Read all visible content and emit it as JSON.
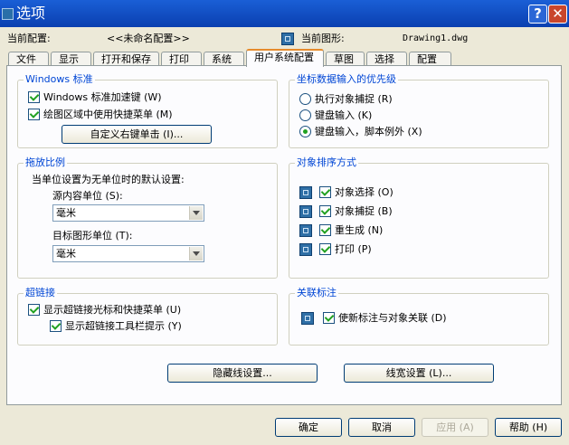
{
  "window": {
    "title": "选项",
    "help_label": "?",
    "close_label": "✕"
  },
  "profile": {
    "label": "当前配置:",
    "value": "<<未命名配置>>"
  },
  "drawing": {
    "label": "当前图形:",
    "value": "Drawing1.dwg"
  },
  "tabs": [
    "文件",
    "显示",
    "打开和保存",
    "打印",
    "系统",
    "用户系统配置",
    "草图",
    "选择",
    "配置"
  ],
  "active_tab": "用户系统配置",
  "windows_std": {
    "title": "Windows 标准",
    "accel_keys": "Windows 标准加速键 (W)",
    "shortcut_menus": "绘图区域中使用快捷菜单 (M)",
    "right_click_button": "自定义右键单击 (I)..."
  },
  "priority": {
    "title": "坐标数据输入的优先级",
    "options": [
      "执行对象捕捉 (R)",
      "键盘输入 (K)",
      "键盘输入，脚本例外 (X)"
    ],
    "selected": 2
  },
  "insert_scale": {
    "title": "拖放比例",
    "desc": "当单位设置为无单位时的默认设置:",
    "source_label": "源内容单位 (S):",
    "source_value": "毫米",
    "target_label": "目标图形单位 (T):",
    "target_value": "毫米"
  },
  "sort": {
    "title": "对象排序方式",
    "items": [
      "对象选择 (O)",
      "对象捕捉 (B)",
      "重生成 (N)",
      "打印 (P)"
    ]
  },
  "hyperlink": {
    "title": "超链接",
    "cursor_menus": "显示超链接光标和快捷菜单 (U)",
    "tooltip": "显示超链接工具栏提示 (Y)"
  },
  "assoc": {
    "title": "关联标注",
    "item": "使新标注与对象关联 (D)"
  },
  "buttons": {
    "hidden_line": "隐藏线设置...",
    "lineweight": "线宽设置 (L)...",
    "ok": "确定",
    "cancel": "取消",
    "apply": "应用 (A)",
    "help": "帮助 (H)"
  }
}
